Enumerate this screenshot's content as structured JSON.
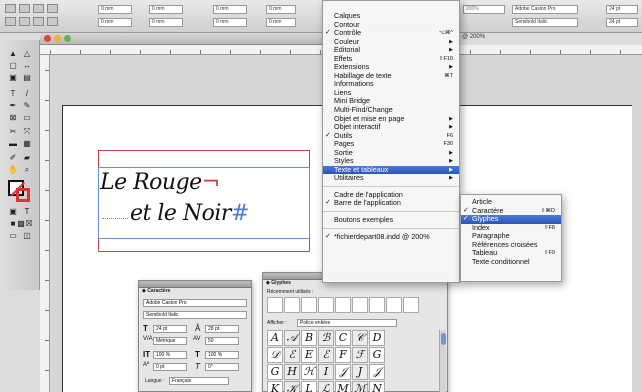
{
  "control_bar": {
    "fields": [
      "0 mm",
      "0 mm",
      "0 mm",
      "0 mm",
      "0 mm",
      "0 mm",
      "0 mm",
      "0 mm"
    ],
    "font_name": "Adobe Caslon Pro",
    "font_style": "Semibold Italic",
    "font_size": "24 pt",
    "font_size_2": "24 pt",
    "zoom_field": "200%"
  },
  "window_tab": {
    "title": "@ 200%"
  },
  "menu": {
    "items": [
      {
        "label": "Calques",
        "check": "",
        "shortcut": "",
        "arrow": ""
      },
      {
        "label": "Contour",
        "check": "",
        "shortcut": "",
        "arrow": ""
      },
      {
        "label": "Contrôle",
        "check": "✓",
        "shortcut": "⌥⌘^",
        "arrow": ""
      },
      {
        "label": "Couleur",
        "check": "",
        "shortcut": "",
        "arrow": "▶"
      },
      {
        "label": "Editorial",
        "check": "",
        "shortcut": "",
        "arrow": "▶"
      },
      {
        "label": "Effets",
        "check": "",
        "shortcut": "⇧F10",
        "arrow": ""
      },
      {
        "label": "Extensions",
        "check": "",
        "shortcut": "",
        "arrow": "▶"
      },
      {
        "label": "Habillage de texte",
        "check": "",
        "shortcut": "⌘T",
        "arrow": ""
      },
      {
        "label": "Informations",
        "check": "",
        "shortcut": "",
        "arrow": ""
      },
      {
        "label": "Liens",
        "check": "",
        "shortcut": "",
        "arrow": ""
      },
      {
        "label": "Mini Bridge",
        "check": "",
        "shortcut": "",
        "arrow": ""
      },
      {
        "label": "Multi-Find/Change",
        "check": "",
        "shortcut": "",
        "arrow": ""
      },
      {
        "label": "Objet et mise en page",
        "check": "",
        "shortcut": "",
        "arrow": "▶"
      },
      {
        "label": "Objet interactif",
        "check": "",
        "shortcut": "",
        "arrow": "▶"
      },
      {
        "label": "Outils",
        "check": "✓",
        "shortcut": "F6",
        "arrow": ""
      },
      {
        "label": "Pages",
        "check": "",
        "shortcut": "F30",
        "arrow": ""
      },
      {
        "label": "Sortie",
        "check": "",
        "shortcut": "",
        "arrow": "▶"
      },
      {
        "label": "Styles",
        "check": "",
        "shortcut": "",
        "arrow": "▶"
      },
      {
        "label": "Texte et tableaux",
        "check": "",
        "shortcut": "",
        "arrow": "▶",
        "highlight": true
      },
      {
        "label": "Utilitaires",
        "check": "",
        "shortcut": "",
        "arrow": "▶"
      }
    ],
    "items_b": [
      {
        "label": "Cadre de l'application",
        "check": ""
      },
      {
        "label": "Barre de l'application",
        "check": "✓"
      }
    ],
    "items_c": [
      {
        "label": "Boutons exemples",
        "check": ""
      }
    ],
    "items_d": [
      {
        "label": "*fichierdepart08.indd @ 200%",
        "check": "✓"
      }
    ]
  },
  "submenu": {
    "items": [
      {
        "label": "Article",
        "check": "",
        "shortcut": ""
      },
      {
        "label": "Caractère",
        "check": "✓",
        "shortcut": "⇧⌘D"
      },
      {
        "label": "Glyphes",
        "check": "✓",
        "shortcut": "",
        "highlight": true
      },
      {
        "label": "Index",
        "check": "",
        "shortcut": "⇧F8"
      },
      {
        "label": "Paragraphe",
        "check": "",
        "shortcut": ""
      },
      {
        "label": "Références croisées",
        "check": "",
        "shortcut": ""
      },
      {
        "label": "Tableau",
        "check": "",
        "shortcut": "⇧F9"
      },
      {
        "label": "Texte conditionnel",
        "check": "",
        "shortcut": ""
      }
    ]
  },
  "document": {
    "line1": "Le Rouge",
    "line1_mark": "¬",
    "line2": "et le Noir",
    "line2_mark": "#"
  },
  "caractere_panel": {
    "tab": "◆ Caractère",
    "font": "Adobe Caslon Pro",
    "style": "Semibold Italic",
    "size": "24 pt",
    "leading": "28 pt",
    "kerning": "Métrique",
    "tracking": "50",
    "vscale": "100 %",
    "hscale": "100 %",
    "baseline": "0 pt",
    "skew": "0°",
    "language_label": "Langue :",
    "language": "Français"
  },
  "glyphes_panel": {
    "tab": "◆ Glyphes",
    "recent_label": "Récemment utilisés :",
    "show_label": "Afficher :",
    "show_value": "Police entière",
    "glyphs": [
      [
        "A",
        "𝒜",
        "B",
        "ℬ",
        "C",
        "𝒞",
        "D"
      ],
      [
        "𝒟",
        "ℰ",
        "E",
        "ℰ",
        "F",
        "ℱ",
        "G"
      ],
      [
        "G",
        "H",
        "ℋ",
        "I",
        "𝒥",
        "J",
        "𝒥"
      ],
      [
        "K",
        "𝒦",
        "L",
        "ℒ",
        "M",
        "ℳ",
        "N"
      ]
    ]
  },
  "colors": {
    "menu_highlight": "#3a63c6",
    "red_frame": "#cc4444",
    "blue_frame": "#6a8fd0",
    "pilcrow_red": "#d23a3a",
    "hash_blue": "#4f7bd6"
  }
}
